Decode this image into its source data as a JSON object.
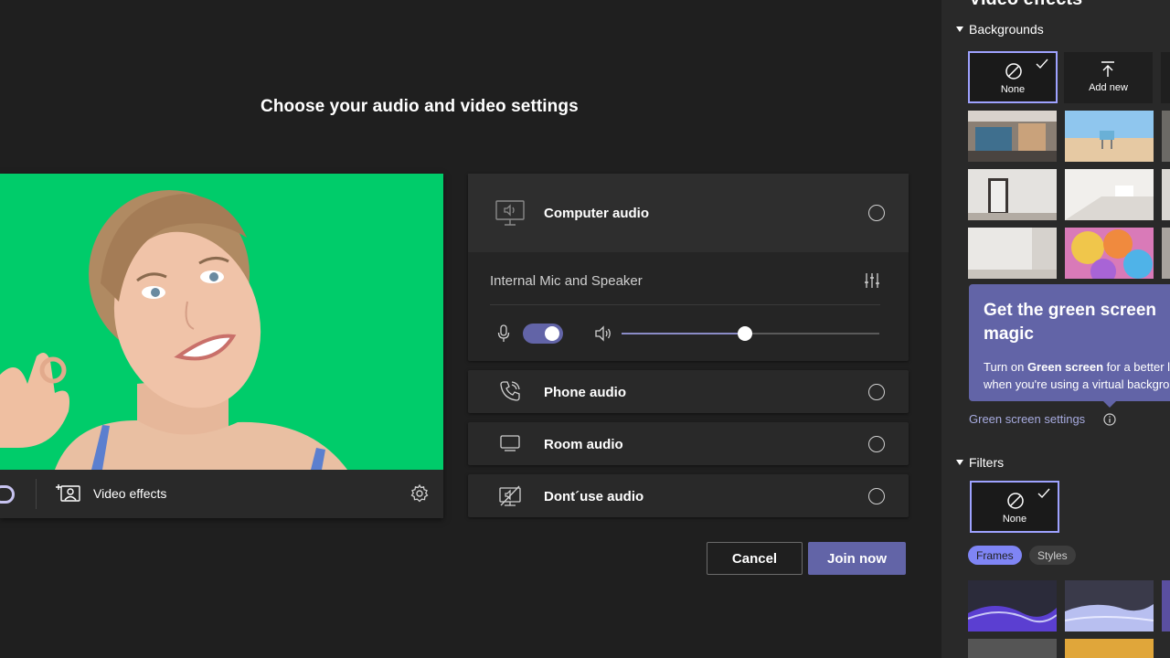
{
  "page": {
    "title": "Choose your audio and video settings"
  },
  "preview": {
    "video_effects_label": "Video effects"
  },
  "audio_options": [
    {
      "label": "Computer audio",
      "icon": "computer-speaker-icon",
      "selected": false
    },
    {
      "label": "Phone audio",
      "icon": "phone-icon",
      "selected": false
    },
    {
      "label": "Room audio",
      "icon": "monitor-icon",
      "selected": false
    },
    {
      "label": "Dont´use audio",
      "icon": "speaker-off-icon",
      "selected": false
    }
  ],
  "computer_audio": {
    "device_name": "Internal Mic and Speaker",
    "mic_on": true,
    "volume_fraction": 0.48
  },
  "buttons": {
    "cancel": "Cancel",
    "join": "Join now"
  },
  "panel": {
    "title": "Video effects",
    "backgrounds_heading": "Backgrounds",
    "none_label": "None",
    "add_new_label": "Add new",
    "promo_title": "Get the green screen magic",
    "promo_text_1a": "Turn on ",
    "promo_text_1b": "Green screen",
    "promo_text_1c": " for a better l",
    "promo_text_2": "when you're using a virtual backgro",
    "green_screen_link": "Green screen settings",
    "filters_heading": "Filters",
    "filter_none_label": "None",
    "frames_tab": "Frames",
    "styles_tab": "Styles"
  },
  "colors": {
    "accent": "#6264a7",
    "accent_light": "#9ea2ff",
    "green_screen": "#00cc6a",
    "background": "#1f1f1f",
    "surface": "#292929"
  }
}
